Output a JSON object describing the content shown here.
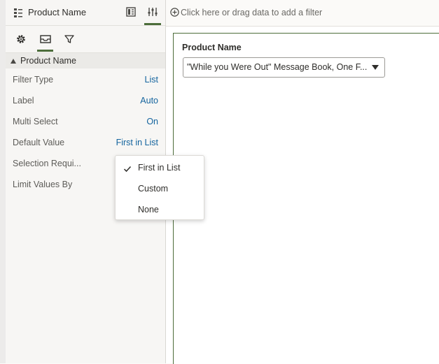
{
  "panel": {
    "title": "Product Name",
    "header_icons": [
      "grid-layout-icon",
      "sliders-icon"
    ],
    "tabs": [
      "gear-icon",
      "inbox-icon",
      "filter-icon"
    ],
    "section": "Product Name",
    "properties": [
      {
        "label": "Filter Type",
        "value": "List"
      },
      {
        "label": "Label",
        "value": "Auto"
      },
      {
        "label": "Multi Select",
        "value": "On"
      },
      {
        "label": "Default Value",
        "value": "First in List"
      },
      {
        "label": "Selection Requi...",
        "value": ""
      },
      {
        "label": "Limit Values By",
        "value": ""
      }
    ]
  },
  "filter_bar": {
    "hint": "Click here or drag data to add a filter"
  },
  "canvas": {
    "field_label": "Product Name",
    "selected_value": "\"While you Were Out\" Message Book, One F..."
  },
  "dropdown": {
    "items": [
      {
        "label": "First in List",
        "checked": true
      },
      {
        "label": "Custom",
        "checked": false
      },
      {
        "label": "None",
        "checked": false
      }
    ]
  },
  "colors": {
    "accent_green": "#4c6d3a",
    "link_blue": "#14649e"
  }
}
